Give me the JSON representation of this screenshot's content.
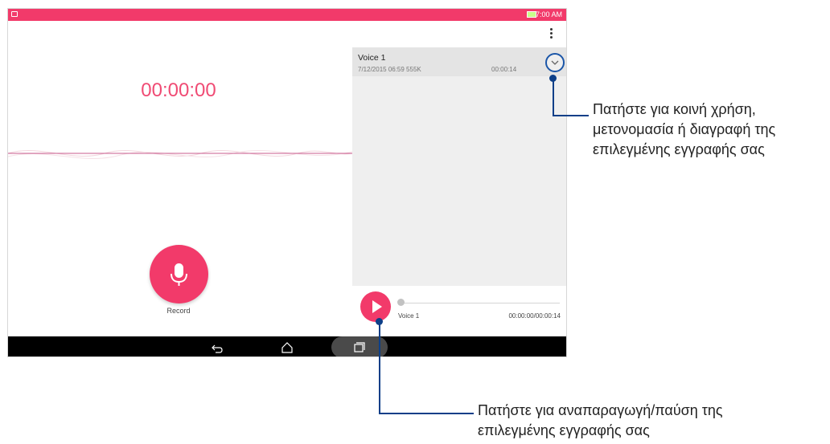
{
  "status_bar": {
    "time": "7:00 AM"
  },
  "recorder": {
    "timer": "00:00:00",
    "record_label": "Record"
  },
  "recording": {
    "title": "Voice 1",
    "date_size": "7/12/2015 06:59  555K",
    "duration": "00:00:14"
  },
  "player": {
    "title": "Voice 1",
    "time": "00:00:00/00:00:14",
    "progress": 0
  },
  "callouts": {
    "options_text": [
      "Πατήστε για κοινή χρήση,",
      "μετονομασία ή διαγραφή της",
      "επιλεγμένης εγγραφής σας"
    ],
    "play_text": [
      "Πατήστε για αναπαραγωγή/παύση της",
      "επιλεγμένης εγγραφής σας"
    ]
  },
  "icons": {
    "menu": "more-vert-icon",
    "record": "microphone-icon",
    "play": "play-icon",
    "options": "chevron-down-icon",
    "back": "back-icon",
    "home": "home-icon",
    "recents": "recents-icon"
  },
  "colors": {
    "accent": "#f23a6a",
    "callout": "#0d3f88"
  }
}
